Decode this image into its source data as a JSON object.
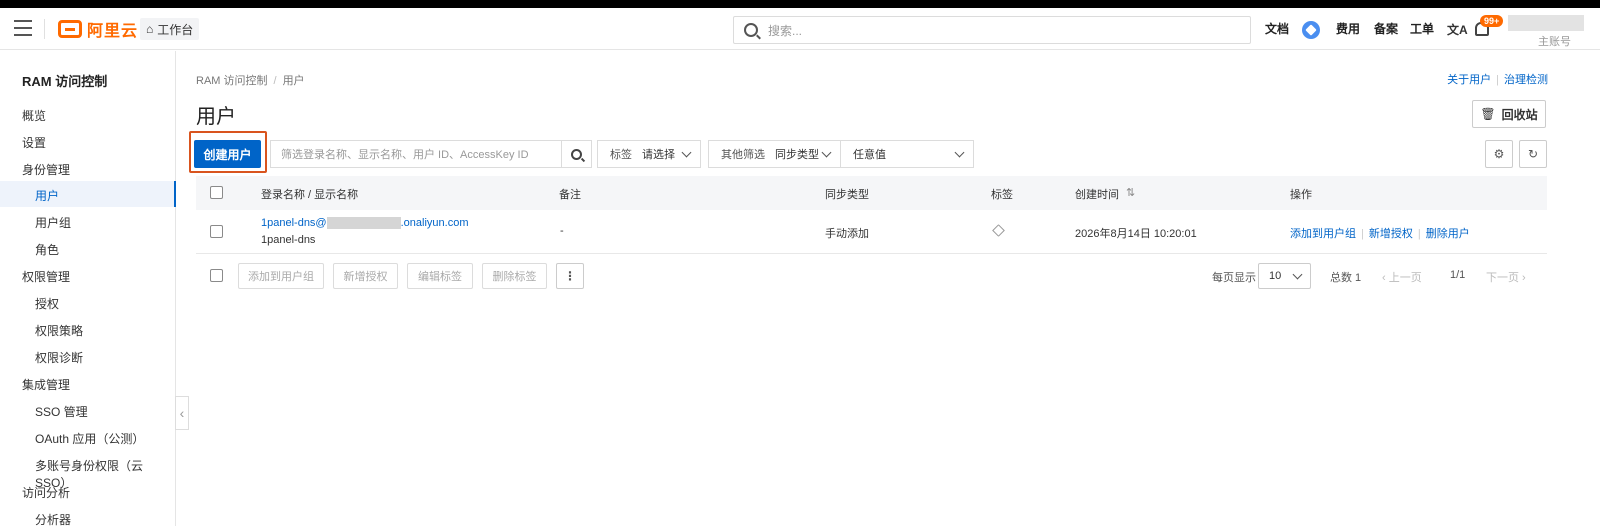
{
  "header": {
    "logo_text": "阿里云",
    "workbench": "工作台",
    "search_placeholder": "搜索...",
    "nav": {
      "docs": "文档",
      "cost": "费用",
      "icp": "备案",
      "ticket": "工单"
    },
    "lang_icon": "文A",
    "badge": "99+",
    "account_label": "主账号"
  },
  "sidebar": {
    "title": "RAM 访问控制",
    "items": [
      {
        "label": "概览"
      },
      {
        "label": "设置"
      },
      {
        "label": "身份管理"
      },
      {
        "label": "用户"
      },
      {
        "label": "用户组"
      },
      {
        "label": "角色"
      },
      {
        "label": "权限管理"
      },
      {
        "label": "授权"
      },
      {
        "label": "权限策略"
      },
      {
        "label": "权限诊断"
      },
      {
        "label": "集成管理"
      },
      {
        "label": "SSO 管理"
      },
      {
        "label": "OAuth 应用（公测）"
      },
      {
        "label": "多账号身份权限（云 SSO）"
      },
      {
        "label": "访问分析"
      },
      {
        "label": "分析器"
      }
    ]
  },
  "breadcrumb": {
    "root": "RAM 访问控制",
    "sep": "/",
    "current": "用户"
  },
  "top_links": {
    "about": "关于用户",
    "governance": "治理检测"
  },
  "page_title": "用户",
  "recycle_label": "回收站",
  "toolbar": {
    "create_label": "创建用户",
    "filter_placeholder": "筛选登录名称、显示名称、用户 ID、AccessKey ID",
    "tag_label": "标签",
    "tag_value": "请选择",
    "other_label": "其他筛选",
    "other_value": "同步类型",
    "any_value": "任意值"
  },
  "table": {
    "columns": {
      "login": "登录名称 / 显示名称",
      "remark": "备注",
      "sync": "同步类型",
      "tag": "标签",
      "created": "创建时间",
      "sort_icon": "⇅",
      "ops": "操作"
    },
    "rows": [
      {
        "login_prefix": "1panel-dns@",
        "login_suffix": ".onaliyun.com",
        "display_name": "1panel-dns",
        "remark": "-",
        "sync": "手动添加",
        "created": "2026年8月14日 10:20:01",
        "ops": [
          "添加到用户组",
          "新增授权",
          "删除用户"
        ]
      }
    ]
  },
  "bulk": {
    "add_group": "添加到用户组",
    "add_auth": "新增授权",
    "edit_tag": "编辑标签",
    "delete_tag": "删除标签",
    "more": "⋮"
  },
  "pagination": {
    "per_page_label": "每页显示",
    "per_page": "10",
    "total": "总数 1",
    "prev": "上一页",
    "page": "1/1",
    "next": "下一页"
  },
  "colors": {
    "primary": "#0064c8",
    "brand": "#ff6a00",
    "highlight": "#d9541e"
  }
}
